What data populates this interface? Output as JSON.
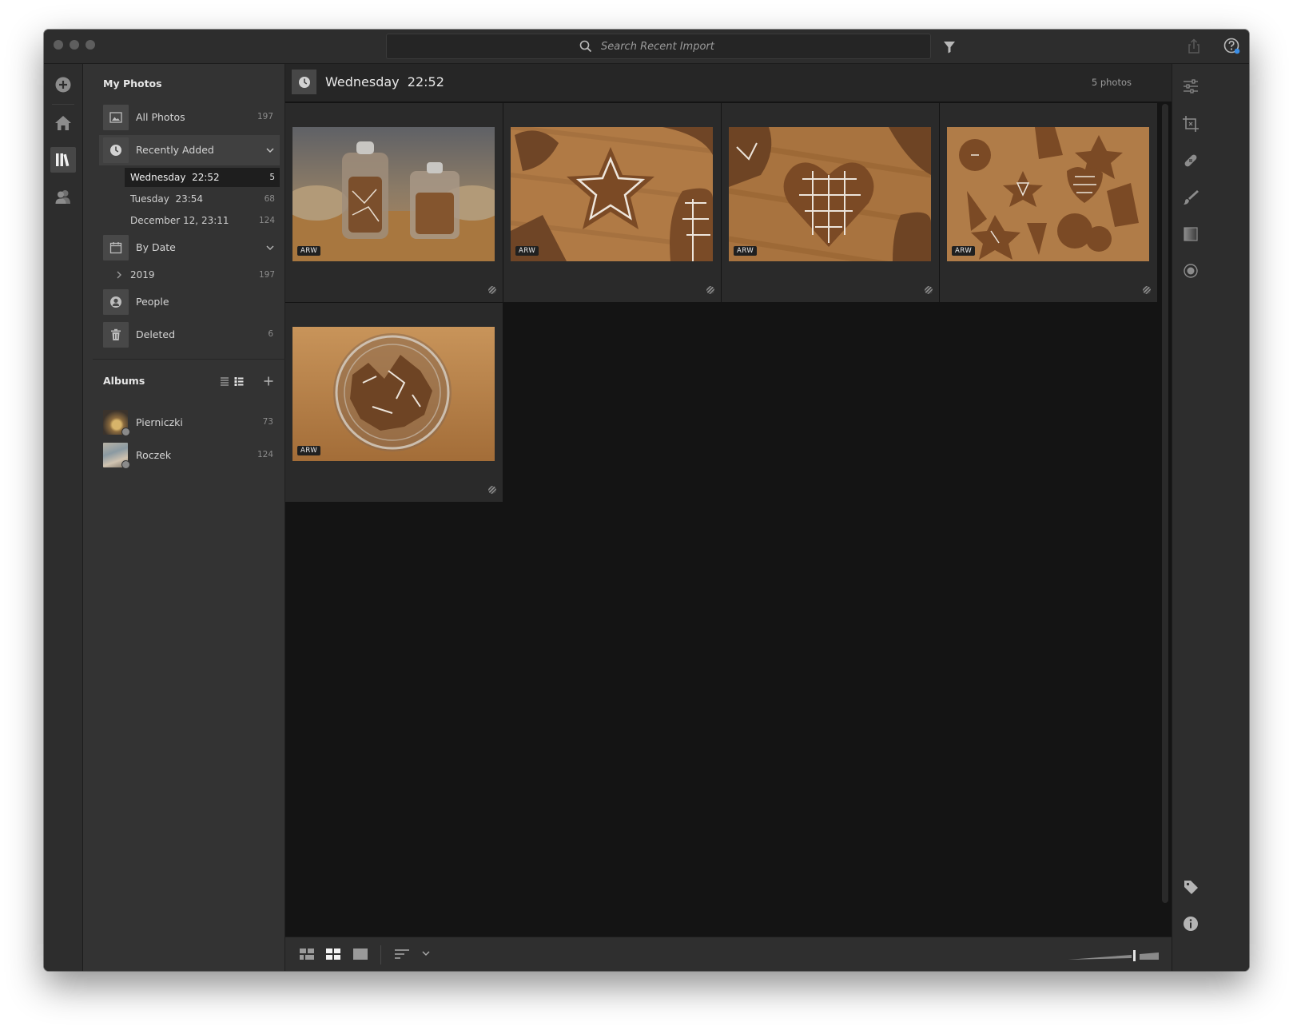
{
  "search": {
    "placeholder": "Search Recent Import"
  },
  "sidebar": {
    "my_photos_title": "My Photos",
    "all_photos": {
      "label": "All Photos",
      "count": "197"
    },
    "recently_added": {
      "label": "Recently Added"
    },
    "recent_items": [
      {
        "label": "Wednesday  22:52",
        "count": "5"
      },
      {
        "label": "Tuesday  23:54",
        "count": "68"
      },
      {
        "label": "December 12, 23:11",
        "count": "124"
      }
    ],
    "by_date": {
      "label": "By Date"
    },
    "year_item": {
      "label": "2019",
      "count": "197"
    },
    "people": {
      "label": "People"
    },
    "deleted": {
      "label": "Deleted",
      "count": "6"
    },
    "albums_title": "Albums",
    "albums": [
      {
        "label": "Pierniczki",
        "count": "73"
      },
      {
        "label": "Roczek",
        "count": "124"
      }
    ]
  },
  "main": {
    "title": "Wednesday  22:52",
    "count": "5 photos",
    "photos": [
      {
        "badge": "ARW",
        "subject": "glass jars with gingerbread"
      },
      {
        "badge": "ARW",
        "subject": "star gingerbread cookie"
      },
      {
        "badge": "ARW",
        "subject": "heart gingerbread cookie"
      },
      {
        "badge": "ARW",
        "subject": "assorted gingerbread cookies"
      },
      {
        "badge": "ARW",
        "subject": "jar of cookies from above"
      }
    ]
  },
  "icons": {
    "titlebar": [
      "search-icon",
      "filter-icon",
      "share-icon",
      "help-icon",
      "cloud-icon"
    ],
    "rail": [
      "add-photos-icon",
      "home-icon",
      "library-icon",
      "people-icon"
    ],
    "right_rail": [
      "edit-sliders-icon",
      "crop-icon",
      "healing-icon",
      "brush-icon",
      "linear-gradient-icon",
      "radial-gradient-icon",
      "tag-icon",
      "info-icon"
    ],
    "bottom": [
      "photo-grid-icon",
      "square-grid-icon",
      "detail-view-icon",
      "sort-icon",
      "chevron-down-icon",
      "thumbnail-size-slider"
    ]
  },
  "colors": {
    "window_bg": "#1b1b1b",
    "sidebar_bg": "#333333",
    "selected_item_bg": "#1e1e1e",
    "accent_blue": "#3b8ee6"
  }
}
